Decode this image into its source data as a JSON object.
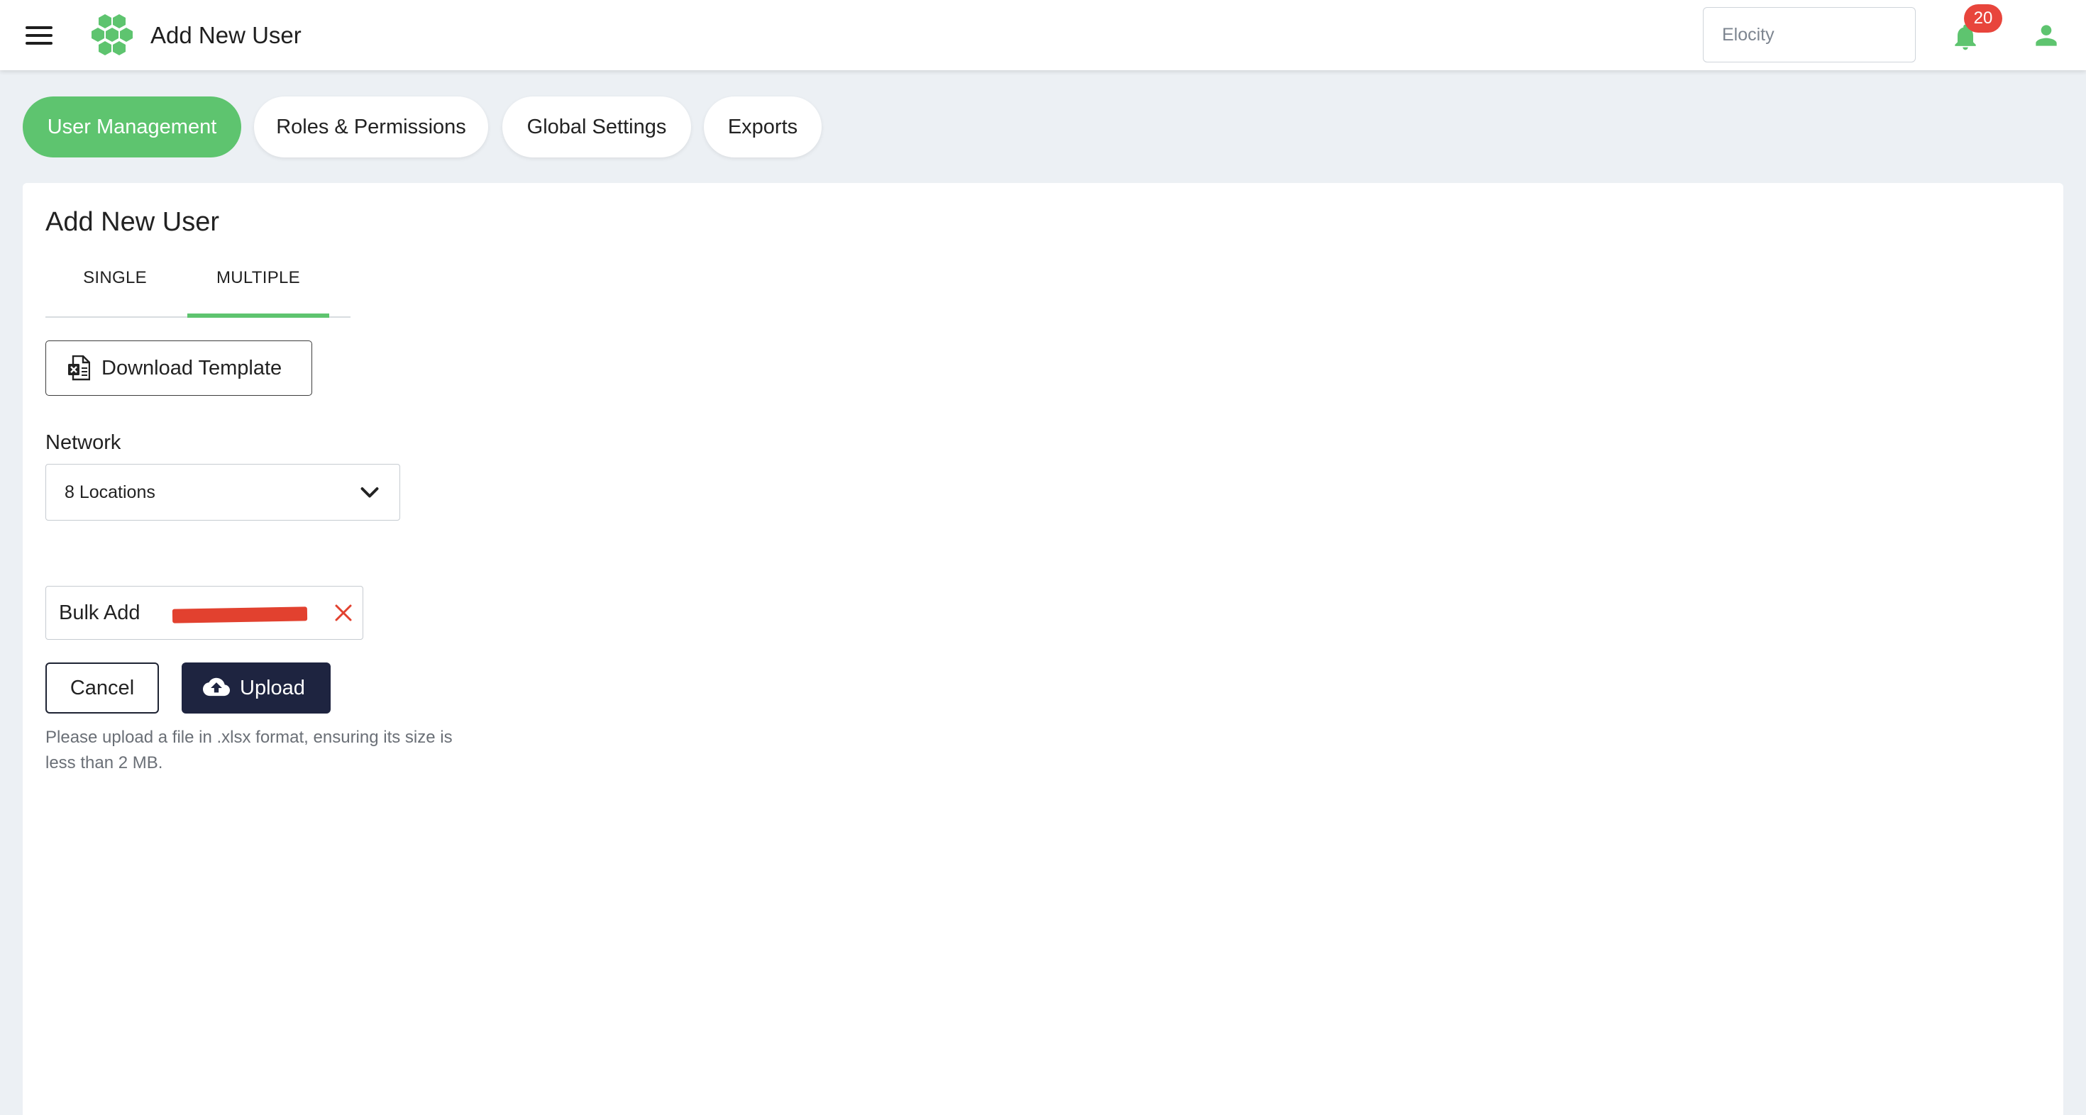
{
  "header": {
    "title": "Add New User",
    "org_select": "Elocity",
    "notification_count": "20"
  },
  "nav_tabs": [
    {
      "label": "User Management",
      "active": true
    },
    {
      "label": "Roles & Permissions",
      "active": false
    },
    {
      "label": "Global Settings",
      "active": false
    },
    {
      "label": "Exports",
      "active": false
    }
  ],
  "card": {
    "title": "Add New User",
    "subtabs": [
      {
        "label": "SINGLE",
        "active": false
      },
      {
        "label": "MULTIPLE",
        "active": true
      }
    ],
    "download_template_label": "Download Template",
    "network_label": "Network",
    "network_value": "8 Locations",
    "file_name_visible": "Bulk Add",
    "cancel_label": "Cancel",
    "upload_label": "Upload",
    "hint": "Please upload a file in .xlsx format, ensuring its size is less than 2 MB."
  },
  "colors": {
    "accent": "#5ec46f",
    "dark_button": "#1e2440",
    "badge": "#e8453c",
    "background": "#ecf0f4",
    "redaction": "#e2412f"
  },
  "icons": {
    "menu": "hamburger-menu-icon",
    "logo": "hexagon-cluster-logo",
    "notifications": "bell-icon",
    "user": "user-icon",
    "template": "excel-file-icon",
    "dropdown": "chevron-down-icon",
    "clear": "close-icon",
    "upload": "cloud-upload-icon"
  }
}
